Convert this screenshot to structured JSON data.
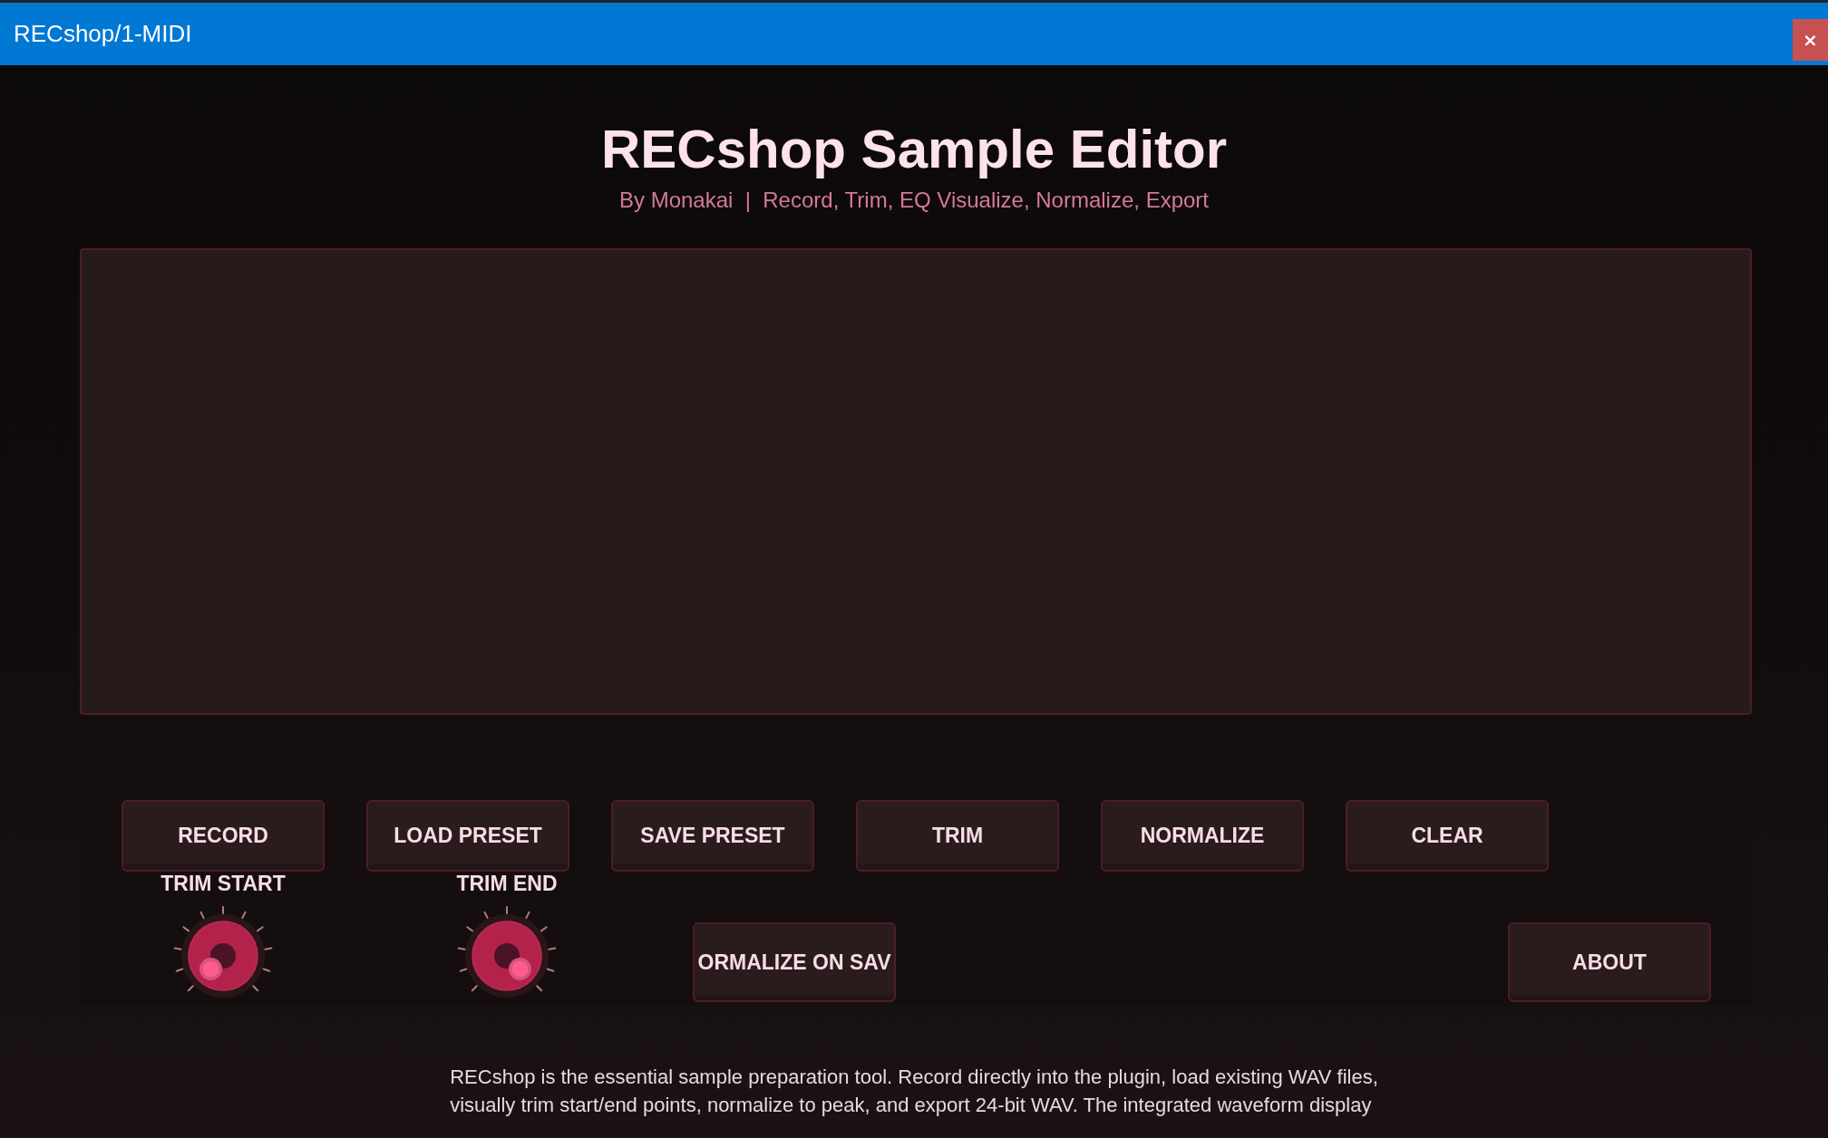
{
  "window": {
    "title": "RECshop/1-MIDI",
    "close_button": "×"
  },
  "header": {
    "title": "RECshop Sample Editor",
    "subtitle": "By Monakai  |  Record, Trim, EQ Visualize, Normalize, Export"
  },
  "controls": {
    "buttons": [
      {
        "label": "RECORD"
      },
      {
        "label": "LOAD PRESET"
      },
      {
        "label": "SAVE PRESET"
      },
      {
        "label": "TRIM"
      },
      {
        "label": "NORMALIZE"
      },
      {
        "label": "CLEAR"
      }
    ],
    "knobs": [
      {
        "label": "TRIM START",
        "level": 0
      },
      {
        "label": "TRIM END",
        "level": 1
      }
    ],
    "secondary_buttons": [
      {
        "label": "ORMALIZE ON SAV"
      },
      {
        "label": "ABOUT"
      }
    ]
  },
  "description": {
    "lines": [
      "RECshop is the essential sample preparation tool. Record directly into the plugin, load existing WAV files,",
      "visually trim start/end points, normalize to peak, and export 24-bit WAV. The integrated waveform display"
    ]
  }
}
